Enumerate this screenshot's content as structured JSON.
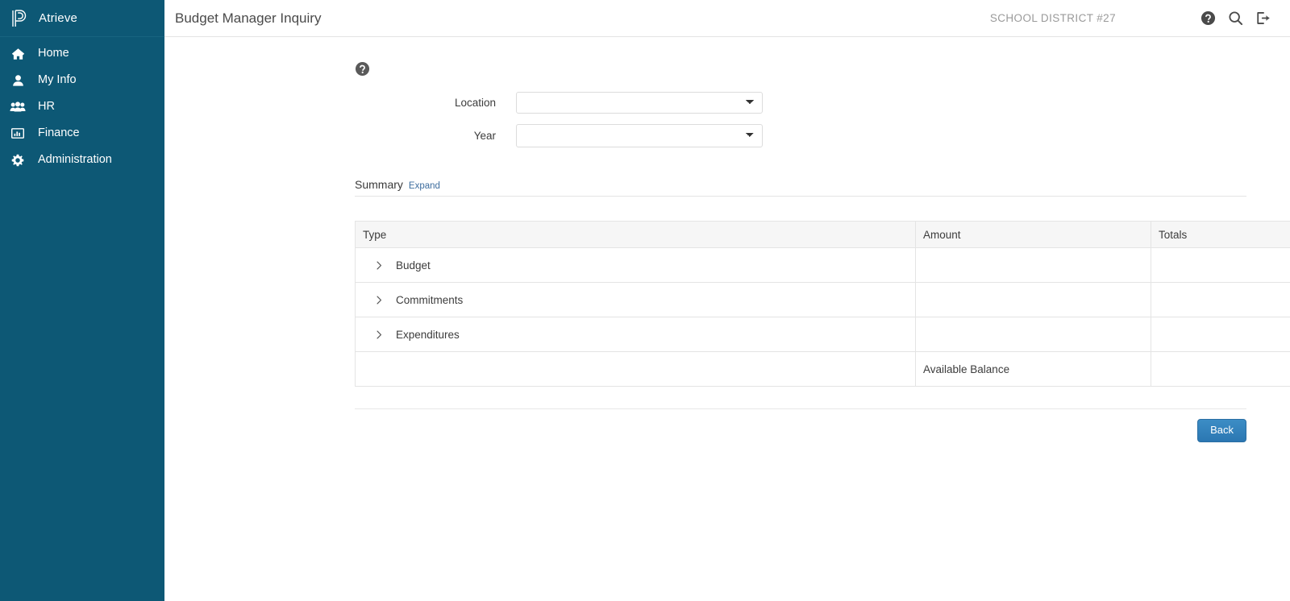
{
  "sidebar": {
    "brand": {
      "name": "Atrieve",
      "logo_icon": "atrieve-p-logo"
    },
    "items": [
      {
        "label": "Home",
        "icon": "home-icon"
      },
      {
        "label": "My Info",
        "icon": "user-icon"
      },
      {
        "label": "HR",
        "icon": "users-group-icon"
      },
      {
        "label": "Finance",
        "icon": "bar-chart-icon"
      },
      {
        "label": "Administration",
        "icon": "gear-icon"
      }
    ]
  },
  "topbar": {
    "title": "Budget Manager Inquiry",
    "district": "SCHOOL DISTRICT #27",
    "icons": [
      {
        "name": "help-icon",
        "glyph": "question-circle"
      },
      {
        "name": "search-icon",
        "glyph": "magnifier"
      },
      {
        "name": "logout-icon",
        "glyph": "sign-out"
      }
    ]
  },
  "content": {
    "help_icon": "help-circle-icon",
    "form": {
      "fields": [
        {
          "label": "Location",
          "value": "",
          "placeholder": ""
        },
        {
          "label": "Year",
          "value": "",
          "placeholder": ""
        }
      ]
    },
    "summary": {
      "title": "Summary",
      "expand_label": "Expand",
      "table": {
        "columns": [
          "Type",
          "Amount",
          "Totals"
        ],
        "rows": [
          {
            "type": "Budget",
            "amount": "",
            "totals": "",
            "expander": "chevron-right-icon"
          },
          {
            "type": "Commitments",
            "amount": "",
            "totals": "",
            "expander": "chevron-right-icon"
          },
          {
            "type": "Expenditures",
            "amount": "",
            "totals": "",
            "expander": "chevron-right-icon"
          }
        ],
        "footer_row": {
          "label": "Available Balance",
          "value": ""
        }
      }
    },
    "actions": {
      "back_label": "Back"
    }
  },
  "colors": {
    "sidebar_bg": "#0d5875",
    "link_blue": "#3d6d9e",
    "button_blue": "#2b77b2",
    "table_header_bg": "#f6f6f6",
    "border": "#e4e4e4"
  }
}
